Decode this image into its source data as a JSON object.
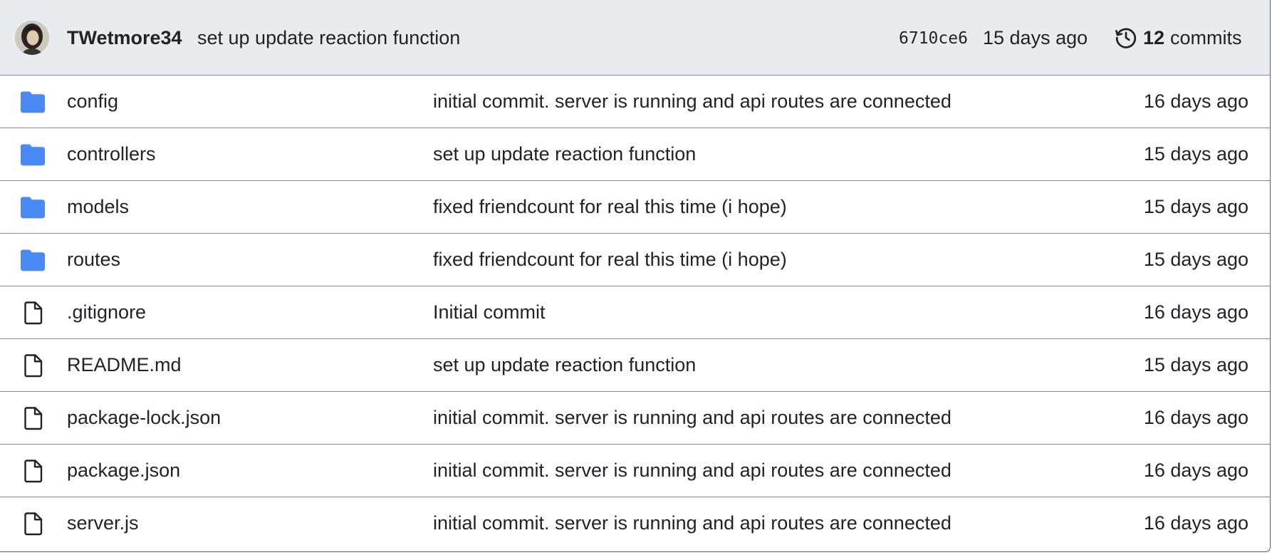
{
  "commit": {
    "author": "TWetmore34",
    "message": "set up update reaction function",
    "sha": "6710ce6",
    "age": "15 days ago",
    "count": "12",
    "count_label": "commits"
  },
  "colors": {
    "folder": "#4a8af4",
    "header_bg": "#e8ebf0",
    "text": "#1f2328"
  },
  "files": [
    {
      "name": "config",
      "type": "folder",
      "icon": "folder-icon",
      "message": "initial commit. server is running and api routes are connected",
      "age": "16 days ago"
    },
    {
      "name": "controllers",
      "type": "folder",
      "icon": "folder-icon",
      "message": "set up update reaction function",
      "age": "15 days ago"
    },
    {
      "name": "models",
      "type": "folder",
      "icon": "folder-icon",
      "message": "fixed friendcount for real this time (i hope)",
      "age": "15 days ago"
    },
    {
      "name": "routes",
      "type": "folder",
      "icon": "folder-icon",
      "message": "fixed friendcount for real this time (i hope)",
      "age": "15 days ago"
    },
    {
      "name": ".gitignore",
      "type": "file",
      "icon": "file-icon",
      "message": "Initial commit",
      "age": "16 days ago"
    },
    {
      "name": "README.md",
      "type": "file",
      "icon": "file-icon",
      "message": "set up update reaction function",
      "age": "15 days ago"
    },
    {
      "name": "package-lock.json",
      "type": "file",
      "icon": "file-icon",
      "message": "initial commit. server is running and api routes are connected",
      "age": "16 days ago"
    },
    {
      "name": "package.json",
      "type": "file",
      "icon": "file-icon",
      "message": "initial commit. server is running and api routes are connected",
      "age": "16 days ago"
    },
    {
      "name": "server.js",
      "type": "file",
      "icon": "file-icon",
      "message": "initial commit. server is running and api routes are connected",
      "age": "16 days ago"
    }
  ]
}
